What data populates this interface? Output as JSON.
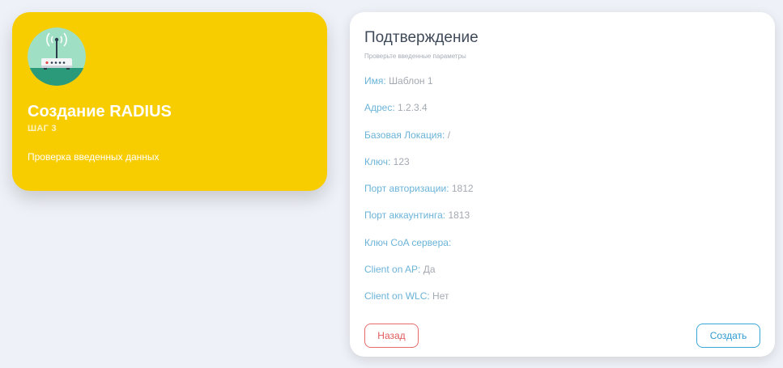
{
  "step_card": {
    "icon": "wifi-router-icon",
    "title": "Создание RADIUS",
    "step": "ШАГ 3",
    "description": "Проверка введенных данных",
    "accent_color": "#f8cd00"
  },
  "confirm": {
    "title": "Подтверждение",
    "subtitle": "Проверьте введенные параметры",
    "fields": [
      {
        "label": "Имя:",
        "value": "Шаблон 1"
      },
      {
        "label": "Адрес:",
        "value": "1.2.3.4"
      },
      {
        "label": "Базовая Локация:",
        "value": "/"
      },
      {
        "label": "Ключ:",
        "value": "123"
      },
      {
        "label": "Порт авторизации:",
        "value": "1812"
      },
      {
        "label": "Порт аккаунтинга:",
        "value": "1813"
      },
      {
        "label": "Ключ CoA сервера:",
        "value": ""
      },
      {
        "label": "Client on AP:",
        "value": "Да"
      },
      {
        "label": "Client on WLC:",
        "value": "Нет"
      }
    ],
    "back_label": "Назад",
    "create_label": "Создать"
  }
}
